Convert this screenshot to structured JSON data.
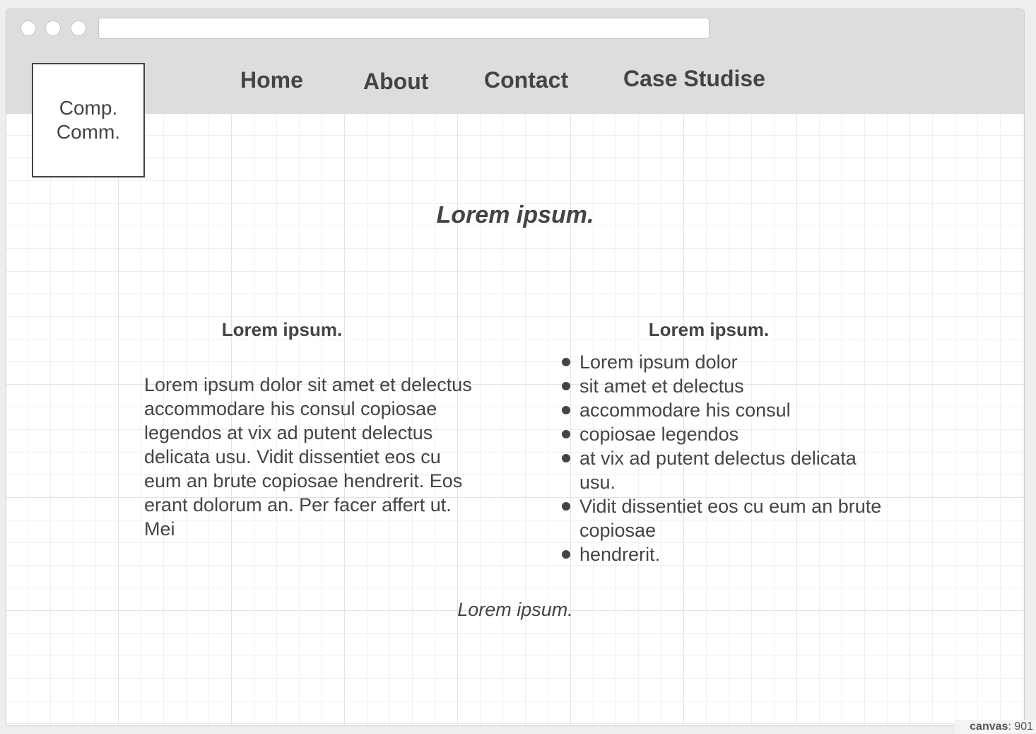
{
  "nav": {
    "items": [
      "Home",
      "About",
      "Contact",
      "Case Studise"
    ]
  },
  "logo": {
    "line1": "Comp.",
    "line2": "Comm."
  },
  "hero": {
    "title": "Lorem ipsum."
  },
  "left_column": {
    "heading": "Lorem ipsum.",
    "body": "Lorem ipsum dolor sit amet et delectus accommodare his consul copiosae legendos at vix ad putent delectus delicata usu. Vidit dissentiet eos cu eum an brute copiosae hendrerit. Eos erant dolorum an. Per facer affert ut. Mei"
  },
  "right_column": {
    "heading": "Lorem ipsum.",
    "items": [
      "Lorem ipsum dolor",
      "sit amet et delectus",
      "accommodare his consul",
      "copiosae legendos",
      "at vix ad putent delectus delicata usu.",
      "Vidit dissentiet eos cu eum an brute copiosae",
      "hendrerit."
    ]
  },
  "footer": {
    "text": "Lorem ipsum."
  },
  "canvas_label": {
    "key": "canvas",
    "value": ": 901"
  }
}
